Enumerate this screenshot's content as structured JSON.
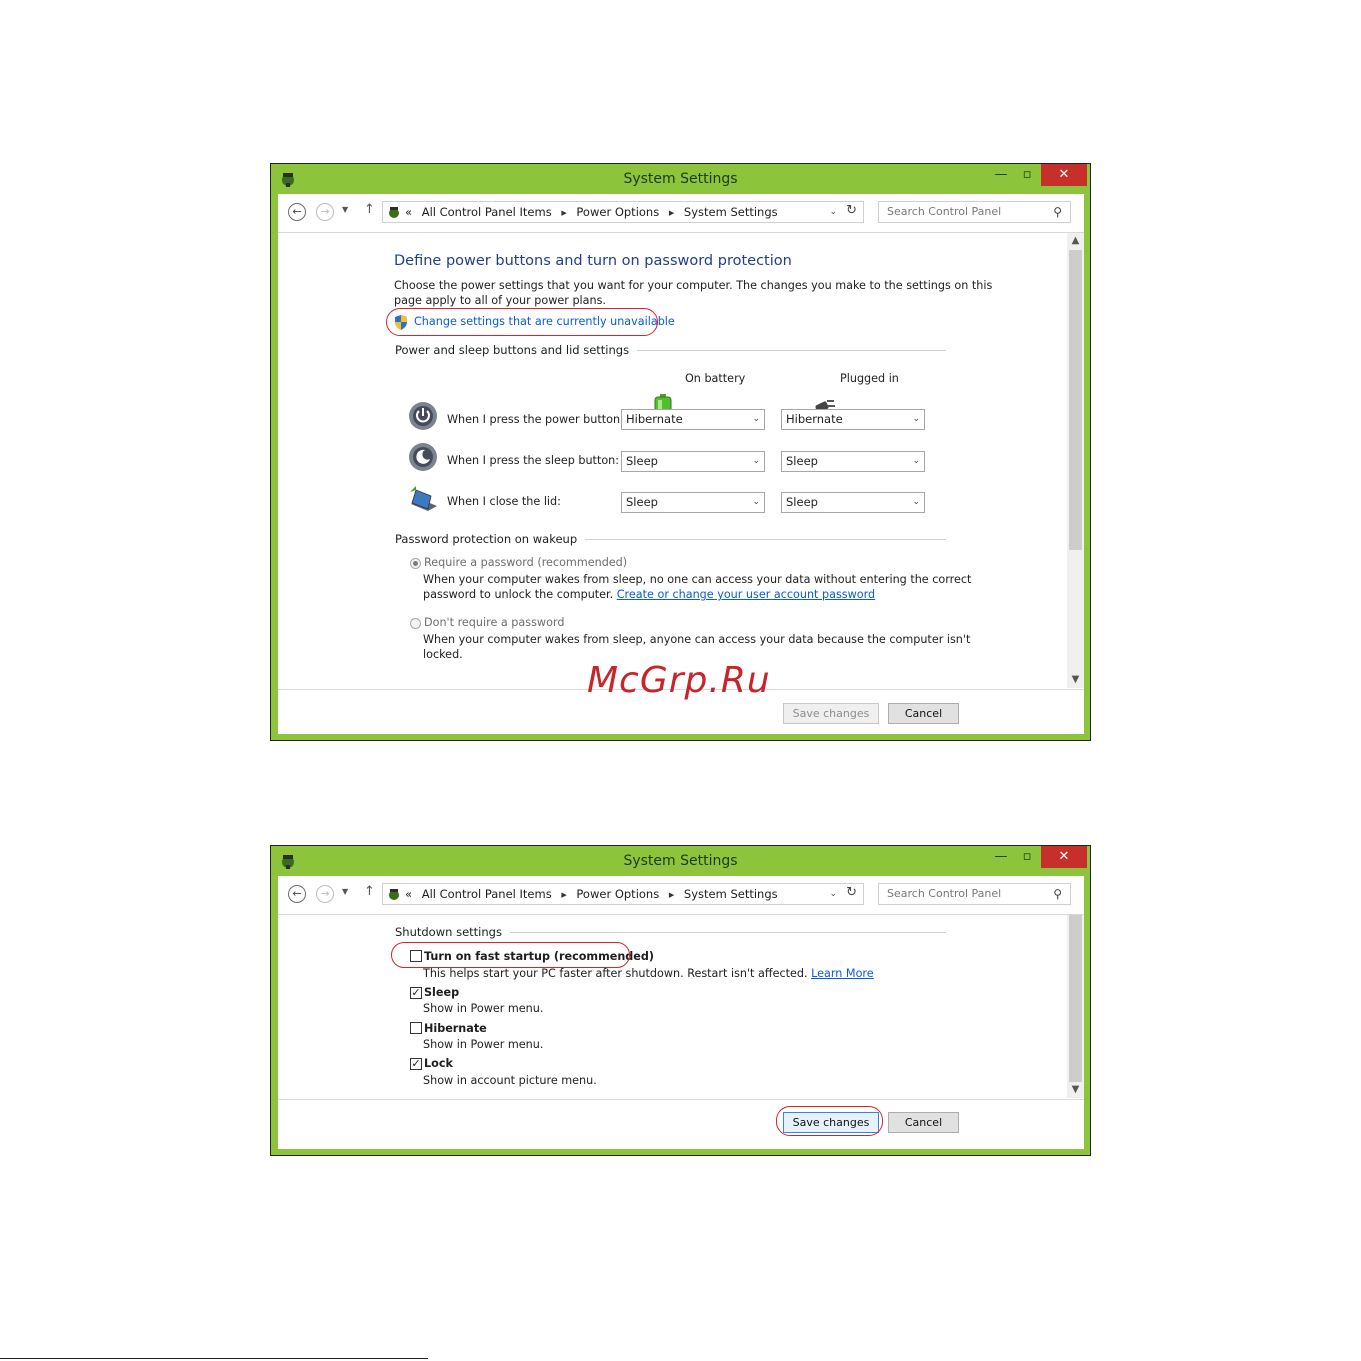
{
  "window1": {
    "title": "System Settings",
    "controls": {
      "minimize": "—",
      "maximize": "▫",
      "close": "✕"
    },
    "address": {
      "prefix": "«",
      "crumbs": [
        "All Control Panel Items",
        "Power Options",
        "System Settings"
      ]
    },
    "search": {
      "placeholder": "Search Control Panel"
    },
    "heading": "Define power buttons and turn on password protection",
    "intro_line1": "Choose the power settings that you want for your computer. The changes you make to the settings on this",
    "intro_line2": "page apply to all of your power plans.",
    "change_link": "Change settings that are currently unavailable",
    "group_power": "Power and sleep buttons and lid settings",
    "col_battery": "On battery",
    "col_plugged": "Plugged in",
    "rows": [
      {
        "label": "When I press the power button:",
        "battery": "Hibernate",
        "plugged": "Hibernate"
      },
      {
        "label": "When I press the sleep button:",
        "battery": "Sleep",
        "plugged": "Sleep"
      },
      {
        "label": "When I close the lid:",
        "battery": "Sleep",
        "plugged": "Sleep"
      }
    ],
    "group_password": "Password protection on wakeup",
    "opt_require": "Require a password (recommended)",
    "opt_require_desc1": "When your computer wakes from sleep, no one can access your data without entering the correct",
    "opt_require_desc2": "password to unlock the computer.",
    "opt_require_link": "Create or change your user account password",
    "opt_norequire": "Don't require a password",
    "opt_norequire_desc1": "When your computer wakes from sleep, anyone can access your data because the computer isn't",
    "opt_norequire_desc2": "locked.",
    "save": "Save changes",
    "cancel": "Cancel"
  },
  "window2": {
    "title": "System Settings",
    "controls": {
      "minimize": "—",
      "maximize": "▫",
      "close": "✕"
    },
    "address": {
      "prefix": "«",
      "crumbs": [
        "All Control Panel Items",
        "Power Options",
        "System Settings"
      ]
    },
    "search": {
      "placeholder": "Search Control Panel"
    },
    "group_shutdown": "Shutdown settings",
    "items": [
      {
        "label": "Turn on fast startup (recommended)",
        "checked": false,
        "desc": "This helps start your PC faster after shutdown. Restart isn't affected.",
        "link": "Learn More"
      },
      {
        "label": "Sleep",
        "checked": true,
        "desc": "Show in Power menu."
      },
      {
        "label": "Hibernate",
        "checked": false,
        "desc": "Show in Power menu."
      },
      {
        "label": "Lock",
        "checked": true,
        "desc": "Show in account picture menu."
      }
    ],
    "save": "Save changes",
    "cancel": "Cancel"
  },
  "watermark": "McGrp.Ru",
  "colors": {
    "titlebar": "#8cc43c",
    "close": "#c7302a",
    "heading": "#1e3f8a",
    "link": "#0b5ccc",
    "highlight_ring": "#d9232a"
  }
}
